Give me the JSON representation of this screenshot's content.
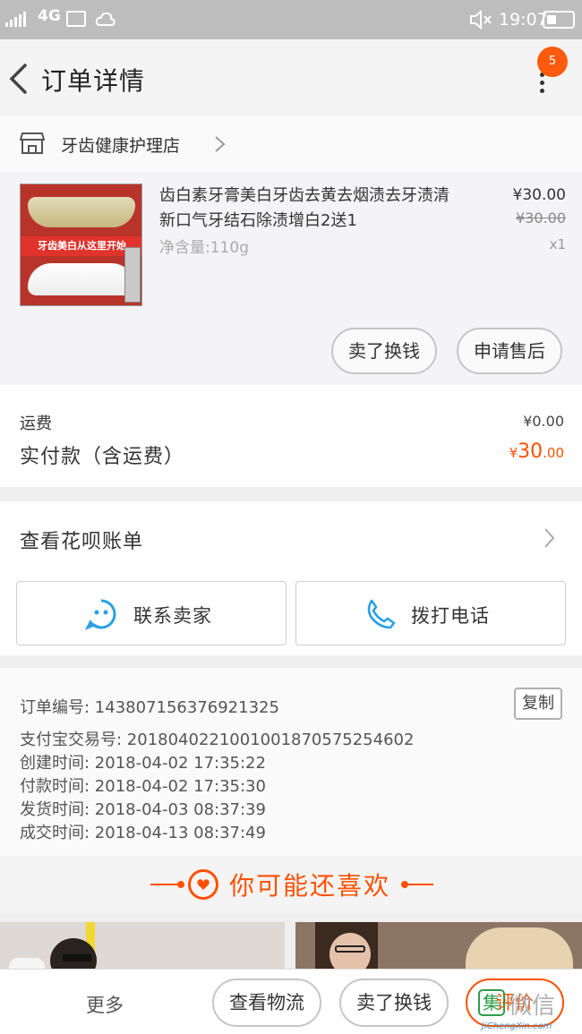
{
  "status_bar": {
    "network": "4G",
    "time": "19:07"
  },
  "header": {
    "title": "订单详情",
    "badge_count": "5"
  },
  "store": {
    "name": "牙齿健康护理店"
  },
  "product": {
    "title": "齿白素牙膏美白牙齿去黄去烟渍去牙渍清新口气牙结石除渍增白2送1",
    "spec": "净含量:110g",
    "price": "¥30.00",
    "original_price": "¥30.00",
    "quantity": "x1",
    "image_caption": "牙齿美白从这里开始",
    "buttons": {
      "sell": "卖了换钱",
      "aftersale": "申请售后"
    }
  },
  "summary": {
    "shipping_label": "运费",
    "shipping_value": "¥0.00",
    "paid_label": "实付款（含运费）",
    "paid_currency": "¥",
    "paid_int": "30",
    "paid_dec": ".00"
  },
  "huabei": {
    "label": "查看花呗账单"
  },
  "contact": {
    "seller_label": "联系卖家",
    "call_label": "拨打电话"
  },
  "order_info": {
    "order_no": "订单编号: 143807156376921325",
    "alipay_no": "支付宝交易号: 2018040221001001870575254602",
    "created": "创建时间: 2018-04-02 17:35:22",
    "paid": "付款时间: 2018-04-02 17:35:30",
    "shipped": "发货时间: 2018-04-03 08:37:39",
    "completed": "成交时间: 2018-04-13 08:37:49",
    "copy_label": "复制"
  },
  "recommend": {
    "title": "你可能还喜欢"
  },
  "bottom_bar": {
    "more": "更多",
    "logistics": "查看物流",
    "sell": "卖了换钱",
    "review": "评价"
  },
  "watermark": {
    "badge": "集",
    "text": "微信",
    "url": "JiChengXin.com"
  },
  "colors": {
    "accent": "#ff5000",
    "badge": "#ff5b0f",
    "status_bar": "#bdbdbd"
  }
}
